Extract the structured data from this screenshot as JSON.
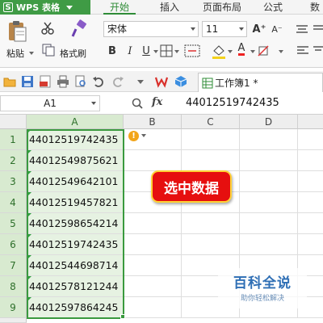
{
  "app": {
    "name": "WPS 表格",
    "logo_letter": "S"
  },
  "menu_tabs": [
    "开始",
    "插入",
    "页面布局",
    "公式",
    "数"
  ],
  "active_tab": "开始",
  "ribbon": {
    "paste_label": "粘贴",
    "format_painter_label": "格式刷",
    "font_name": "宋体",
    "font_size": "11",
    "bold": "B",
    "italic": "I",
    "underline": "U",
    "font_color_glyph": "A",
    "grow_font": "A⁺",
    "shrink_font": "A⁻"
  },
  "document_tab": {
    "name": "工作簿1 *"
  },
  "formula_bar": {
    "name_box": "A1",
    "fx_label": "fx",
    "value": "44012519742435"
  },
  "sheet": {
    "columns": [
      "A",
      "B",
      "C",
      "D"
    ],
    "row_numbers": [
      "1",
      "2",
      "3",
      "4",
      "5",
      "6",
      "7",
      "8",
      "9"
    ],
    "column_a_values": [
      "44012519742435",
      "44012549875621",
      "44012549642101",
      "44012519457821",
      "44012598654214",
      "44012519742435",
      "44012544698714",
      "44012578121244",
      "44012597864245"
    ]
  },
  "warning_icon": "!",
  "callout_text": "选中数据",
  "watermark": {
    "title": "百科全说",
    "subtitle": "助你轻松解决"
  },
  "colors": {
    "app_green": "#3f9b45",
    "selection_green": "#3a9a3e",
    "callout_red": "#e60f0f",
    "callout_border": "#ffd236"
  }
}
